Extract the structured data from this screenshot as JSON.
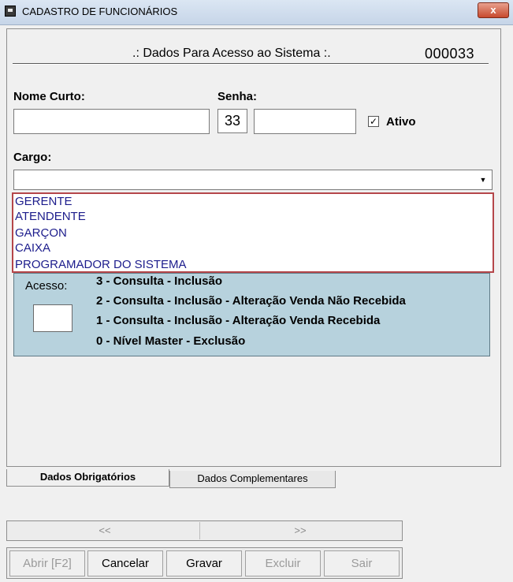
{
  "window": {
    "title": "CADASTRO DE FUNCIONÁRIOS",
    "close_label": "x"
  },
  "header": {
    "section_title": ".: Dados Para Acesso ao Sistema :.",
    "record_id": "000033"
  },
  "form": {
    "nome_curto_label": "Nome Curto:",
    "nome_curto_value": "",
    "senha_label": "Senha:",
    "senha_number": "33",
    "senha_value": "",
    "ativo_label": "Ativo",
    "ativo_checked": true,
    "ativo_mark": "✓",
    "cargo_label": "Cargo:",
    "cargo_value": ""
  },
  "cargo_options": [
    "GERENTE",
    "ATENDENTE",
    "GARÇON",
    "CAIXA",
    "PROGRAMADOR DO SISTEMA"
  ],
  "acesso": {
    "label": "Acesso:",
    "value": "",
    "levels": [
      "3 - Consulta - Inclusão",
      "2 - Consulta - Inclusão - Alteração Venda Não Recebida",
      "1 - Consulta - Inclusão - Alteração Venda Recebida",
      "0 - Nível Master - Exclusão"
    ]
  },
  "tabs": [
    {
      "label": "Dados Obrigatórios",
      "active": true
    },
    {
      "label": "Dados Complementares",
      "active": false
    }
  ],
  "nav": {
    "prev": "<<",
    "next": ">>"
  },
  "buttons": [
    {
      "label": "Abrir [F2]",
      "enabled": false
    },
    {
      "label": "Cancelar",
      "enabled": true
    },
    {
      "label": "Gravar",
      "enabled": true
    },
    {
      "label": "Excluir",
      "enabled": false
    },
    {
      "label": "Sair",
      "enabled": false
    }
  ],
  "colors": {
    "access_panel": "#b7d2dd",
    "dropdown_border": "#b5464a",
    "dropdown_text": "#1c1c8c"
  }
}
